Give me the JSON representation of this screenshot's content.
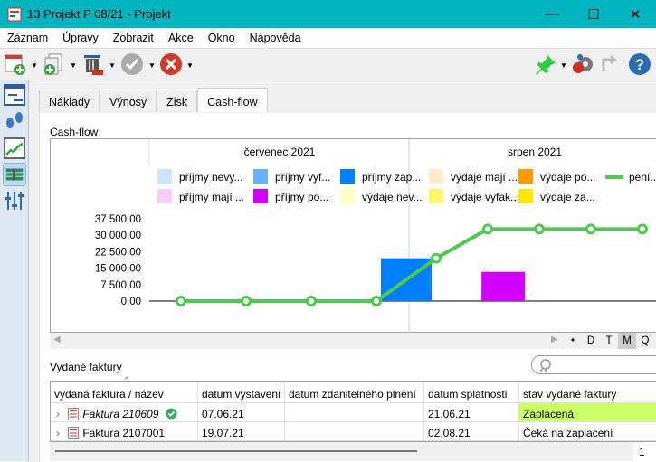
{
  "window": {
    "title": "13 Projekt P 08/21 - Projekt",
    "minimize": "—",
    "maximize": "☐",
    "close": "✕"
  },
  "menu": [
    "Záznam",
    "Úpravy",
    "Zobrazit",
    "Akce",
    "Okno",
    "Nápověda"
  ],
  "tabs": [
    "Náklady",
    "Výnosy",
    "Zisk",
    "Cash-flow"
  ],
  "active_tab": "Cash-flow",
  "chart_section_label": "Cash-flow",
  "chart_data": {
    "type": "bar+line",
    "months": [
      "červenec 2021",
      "srpen 2021"
    ],
    "legend": [
      {
        "name": "příjmy nevy...",
        "color": "#cce4fb"
      },
      {
        "name": "příjmy vyf...",
        "color": "#66b2ff"
      },
      {
        "name": "příjmy zap...",
        "color": "#0080ff"
      },
      {
        "name": "výdaje mají ...",
        "color": "#ffebcc"
      },
      {
        "name": "výdaje po...",
        "color": "#ff9900"
      },
      {
        "name": "pení...",
        "color": "#50c850",
        "line": true
      },
      {
        "name": "příjmy mají ...",
        "color": "#f8ccf8"
      },
      {
        "name": "příjmy po...",
        "color": "#d400ff"
      },
      {
        "name": "výdaje nev...",
        "color": "#ffffcc"
      },
      {
        "name": "výdaje vyfak...",
        "color": "#fff566"
      },
      {
        "name": "výdaje za...",
        "color": "#ffe800"
      }
    ],
    "y_ticks": [
      "37 500,00",
      "30 000,00",
      "22 500,00",
      "15 000,00",
      "7 500,00",
      "0,00"
    ],
    "y_tick_values": [
      37500,
      30000,
      22500,
      15000,
      7500,
      0
    ],
    "ylim": [
      0,
      37500
    ],
    "bars": [
      {
        "series": "příjmy zap...",
        "period_index": 3.5,
        "value": 19500,
        "color": "#0080ff"
      },
      {
        "series": "příjmy po...",
        "period_index": 5.3,
        "value": 13300,
        "color": "#d400ff"
      }
    ],
    "line": {
      "series": "pení...",
      "values": [
        0,
        0,
        0,
        0,
        19500,
        32800,
        32800,
        32800,
        32800
      ],
      "color": "#50c850"
    }
  },
  "zoom_buttons": [
    "•",
    "D",
    "T",
    "M",
    "Q"
  ],
  "zoom_selected": "M",
  "invoices": {
    "label": "Vydané faktury",
    "search_placeholder": "",
    "columns": [
      "vydaná faktura / název",
      "datum vystavení",
      "datum zdanitelného plnění",
      "datum splatnosti",
      "stav vydané faktury"
    ],
    "rows": [
      {
        "name": "Faktura 210609",
        "issued": "07.06.21",
        "taxable": "",
        "due": "21.06.21",
        "status": "Zaplacená",
        "status_color": "#ccff66",
        "paid_icon": true
      },
      {
        "name": "Faktura 2107001",
        "issued": "19.07.21",
        "taxable": "",
        "due": "02.08.21",
        "status": "Čeká na zaplacení",
        "status_color": "",
        "paid_icon": false
      }
    ],
    "page": "1"
  }
}
